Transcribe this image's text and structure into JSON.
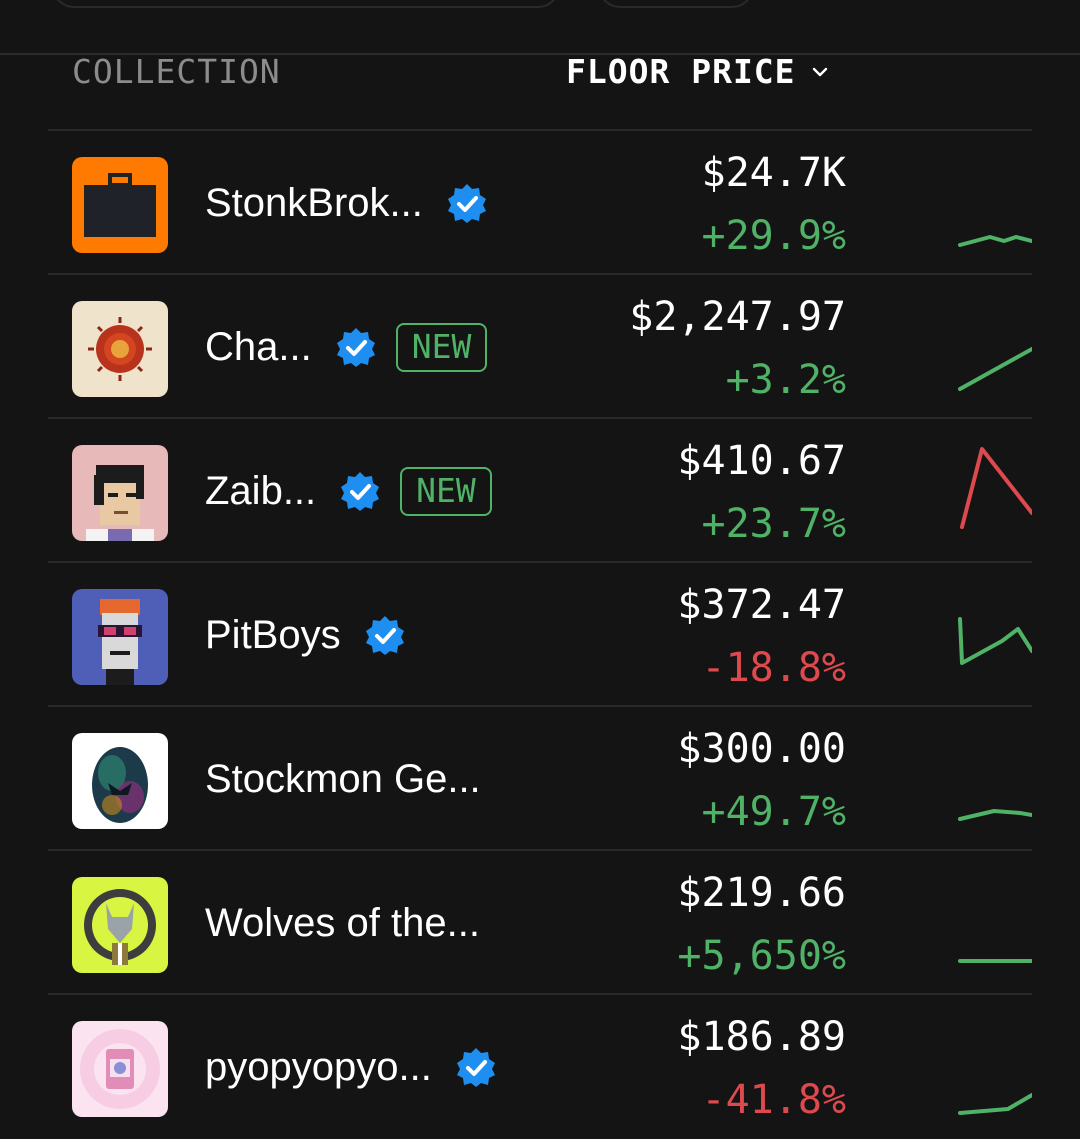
{
  "header": {
    "collection_label": "COLLECTION",
    "floor_price_label": "FLOOR PRICE"
  },
  "colors": {
    "positive": "#4fb266",
    "negative": "#dc4a4e",
    "verified": "#1f8ef1"
  },
  "rows": [
    {
      "name": "StonkBrok...",
      "verified": true,
      "new": false,
      "price": "$24.7K",
      "change": "+29.9%",
      "trend": "up",
      "avatar_icon": "briefcase-icon",
      "sparkline_color": "#4fb266"
    },
    {
      "name": "Cha...",
      "verified": true,
      "new": true,
      "new_label": "NEW",
      "price": "$2,247.97",
      "change": "+3.2%",
      "trend": "up",
      "avatar_icon": "sun-coin-icon",
      "sparkline_color": "#4fb266"
    },
    {
      "name": "Zaib...",
      "verified": true,
      "new": true,
      "new_label": "NEW",
      "price": "$410.67",
      "change": "+23.7%",
      "trend": "up",
      "avatar_icon": "pixel-face-icon",
      "sparkline_color": "#dc4a4e"
    },
    {
      "name": "PitBoys",
      "verified": true,
      "new": false,
      "price": "$372.47",
      "change": "-18.8%",
      "trend": "down",
      "avatar_icon": "pixel-boy-icon",
      "sparkline_color": "#4fb266"
    },
    {
      "name": "Stockmon Ge...",
      "verified": false,
      "new": false,
      "price": "$300.00",
      "change": "+49.7%",
      "trend": "up",
      "avatar_icon": "dragon-egg-icon",
      "sparkline_color": "#4fb266"
    },
    {
      "name": "Wolves of the...",
      "verified": false,
      "new": false,
      "price": "$219.66",
      "change": "+5,650%",
      "trend": "up",
      "avatar_icon": "wolf-icon",
      "sparkline_color": "#4fb266"
    },
    {
      "name": "pyopyopyo...",
      "verified": true,
      "new": false,
      "price": "$186.89",
      "change": "-41.8%",
      "trend": "down",
      "avatar_icon": "card-pack-icon",
      "sparkline_color": "#4fb266"
    }
  ]
}
